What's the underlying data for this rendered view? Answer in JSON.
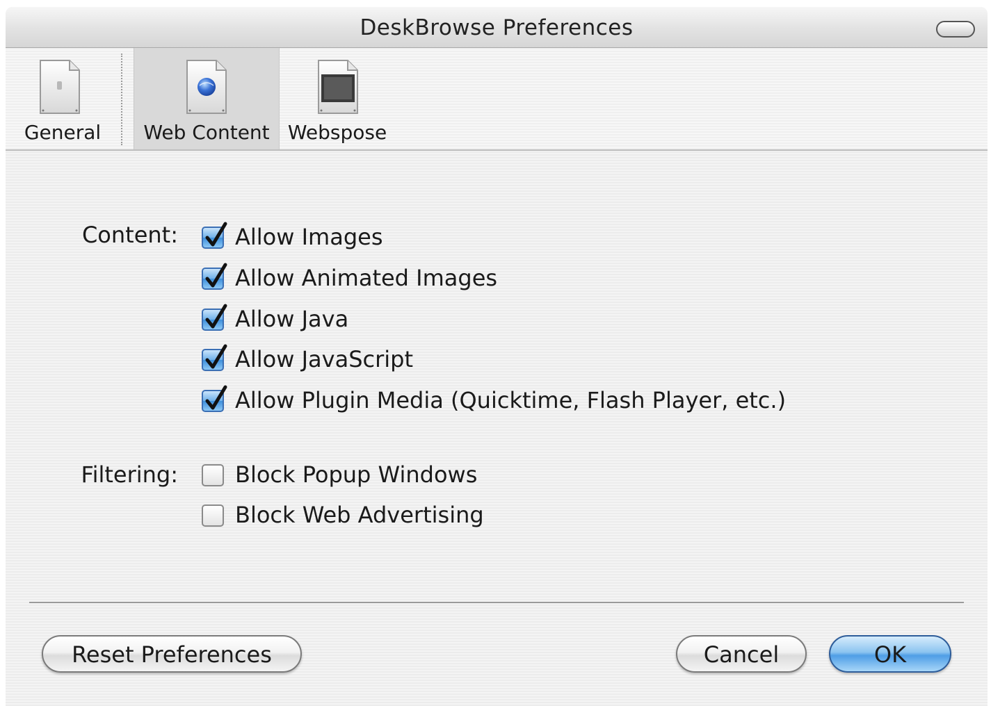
{
  "window": {
    "title": "DeskBrowse Preferences"
  },
  "toolbar": {
    "items": [
      {
        "label": "General",
        "icon": "general-doc-icon"
      },
      {
        "label": "Web Content",
        "icon": "globe-doc-icon",
        "selected": true
      },
      {
        "label": "Webspose",
        "icon": "webspose-doc-icon"
      }
    ]
  },
  "content": {
    "section_label": "Content:",
    "options": [
      {
        "label": "Allow Images",
        "checked": true
      },
      {
        "label": "Allow Animated Images",
        "checked": true
      },
      {
        "label": "Allow Java",
        "checked": true
      },
      {
        "label": "Allow JavaScript",
        "checked": true
      },
      {
        "label": "Allow Plugin Media (Quicktime, Flash Player, etc.)",
        "checked": true
      }
    ]
  },
  "filtering": {
    "section_label": "Filtering:",
    "options": [
      {
        "label": "Block Popup Windows",
        "checked": false
      },
      {
        "label": "Block Web Advertising",
        "checked": false
      }
    ]
  },
  "buttons": {
    "reset": "Reset Preferences",
    "cancel": "Cancel",
    "ok": "OK"
  },
  "colors": {
    "accent_blue": "#4f9ee6",
    "checkbox_blue": "#3d8fdc"
  }
}
